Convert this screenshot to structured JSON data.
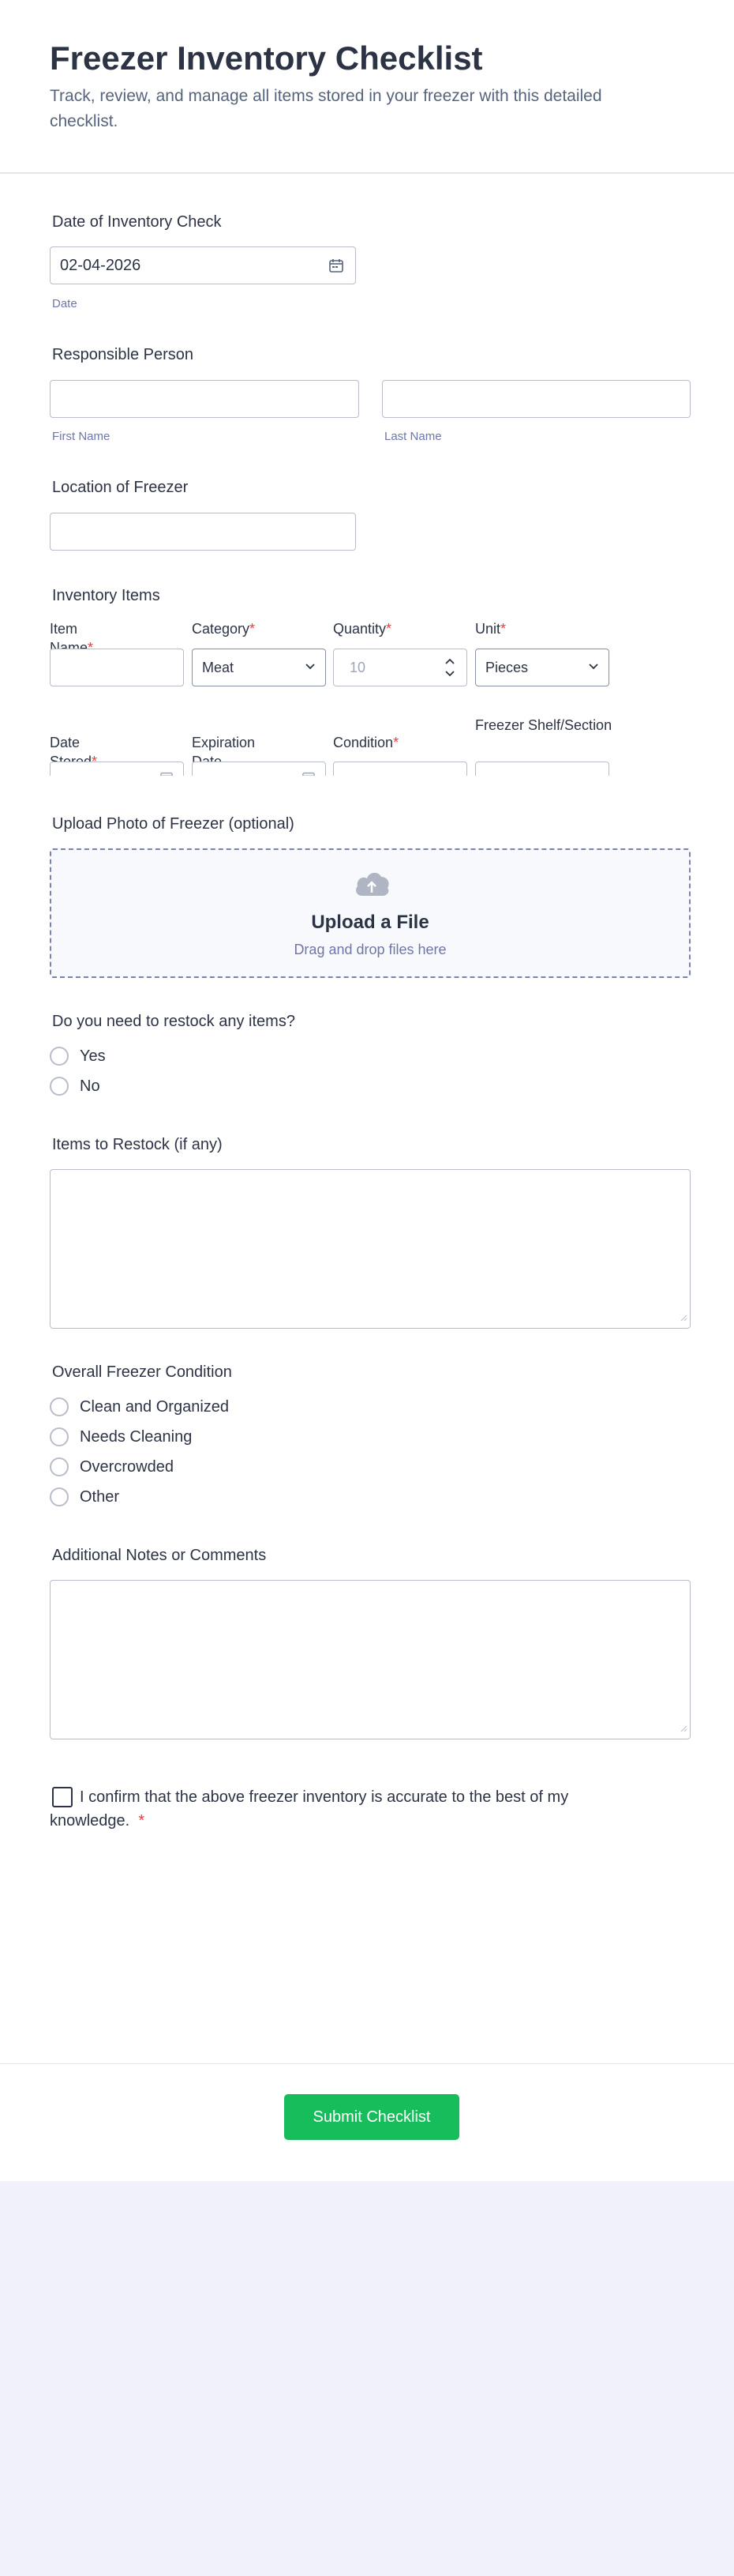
{
  "header": {
    "title": "Freezer Inventory Checklist",
    "subtitle": "Track, review, and manage all items stored in your freezer with this detailed checklist."
  },
  "date_check": {
    "label": "Date of Inventory Check",
    "value": "02-04-2026",
    "sublabel": "Date",
    "icon": "calendar-icon"
  },
  "responsible": {
    "label": "Responsible Person",
    "first_name_value": "",
    "first_name_sublabel": "First Name",
    "last_name_value": "",
    "last_name_sublabel": "Last Name"
  },
  "location": {
    "label": "Location of Freezer",
    "value": ""
  },
  "inventory": {
    "label": "Inventory Items",
    "row1": {
      "item_name": "Item Name",
      "category": "Category",
      "quantity": "Quantity",
      "unit": "Unit",
      "required_mark": "*"
    },
    "row1_values": {
      "item_name": "",
      "category": "Meat",
      "quantity_placeholder": "10",
      "unit": "Pieces"
    },
    "row2": {
      "date_stored": "Date Stored",
      "expiration_date": "Expiration Date",
      "condition": "Condition",
      "shelf": "Freezer Shelf/Section"
    }
  },
  "upload": {
    "label": "Upload Photo of Freezer (optional)",
    "title": "Upload a File",
    "subtitle": "Drag and drop files here",
    "icon": "cloud-upload-icon"
  },
  "restock": {
    "label": "Do you need to restock any items?",
    "options": [
      "Yes",
      "No"
    ]
  },
  "restock_items": {
    "label": "Items to Restock (if any)",
    "value": ""
  },
  "condition": {
    "label": "Overall Freezer Condition",
    "options": [
      "Clean and Organized",
      "Needs Cleaning",
      "Overcrowded",
      "Other"
    ]
  },
  "notes": {
    "label": "Additional Notes or Comments",
    "value": ""
  },
  "confirm": {
    "text": "I confirm that the above freezer inventory is accurate to the best of my knowledge.",
    "required_mark": "*"
  },
  "footer": {
    "submit_label": "Submit Checklist"
  },
  "colors": {
    "accent": "#18bd5b",
    "required": "#f23a3c",
    "text": "#2c3345",
    "muted": "#6f76a7",
    "page_bg": "#f1f1fb"
  }
}
